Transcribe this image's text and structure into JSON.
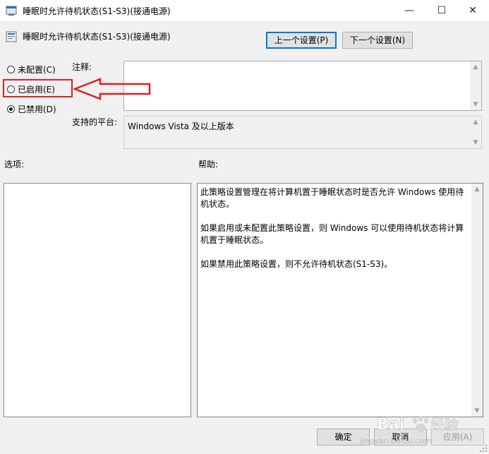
{
  "window": {
    "title": "睡眠时允许待机状态(S1-S3)(接通电源)",
    "minimize_glyph": "—",
    "maximize_glyph": "☐",
    "close_glyph": "✕"
  },
  "header": {
    "setting_title": "睡眠时允许待机状态(S1-S3)(接通电源)",
    "prev_button": "上一个设置(P)",
    "next_button": "下一个设置(N)"
  },
  "state_options": [
    {
      "label": "未配置(C)",
      "checked": false
    },
    {
      "label": "已启用(E)",
      "checked": false
    },
    {
      "label": "已禁用(D)",
      "checked": true
    }
  ],
  "comment": {
    "label": "注释:",
    "value": ""
  },
  "platform": {
    "label": "支持的平台:",
    "value": "Windows Vista 及以上版本"
  },
  "options": {
    "label": "选项:"
  },
  "help": {
    "label": "帮助:",
    "paragraphs": [
      "此策略设置管理在将计算机置于睡眠状态时是否允许 Windows 使用待机状态。",
      "如果启用或未配置此策略设置，则 Windows 可以使用待机状态将计算机置于睡眠状态。",
      "如果禁用此策略设置，则不允许待机状态(S1-S3)。"
    ]
  },
  "footer": {
    "ok_button": "确定",
    "cancel_button": "取消",
    "apply_button": "应用(A)"
  },
  "annotation": {
    "color": "#e02020"
  },
  "watermark": {
    "brand": "Baidu 经验",
    "url": "jingyan.baidu.com"
  }
}
